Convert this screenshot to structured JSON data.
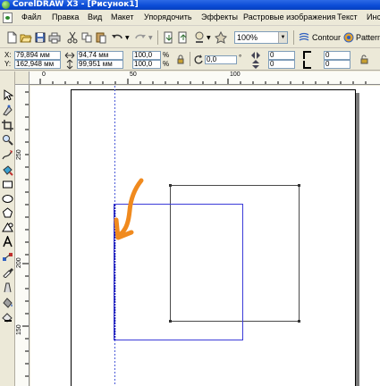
{
  "window": {
    "title": "CorelDRAW X3 - [Рисунок1]"
  },
  "menu": {
    "items": [
      "Файл",
      "Правка",
      "Вид",
      "Макет",
      "Упорядочить",
      "Эффекты",
      "Растровые изображения",
      "Текст",
      "Инс"
    ]
  },
  "toolbar": {
    "zoom_value": "100%",
    "contour_label": "Contour",
    "pattern_label": "Pattern"
  },
  "property_bar": {
    "x_label": "X:",
    "x_value": "79,894 мм",
    "y_label": "Y:",
    "y_value": "162,948 мм",
    "width_value": "94,74 мм",
    "height_value": "99,951 мм",
    "scale_x": "100,0",
    "scale_y": "100,0",
    "percent_1": "%",
    "percent_2": "%",
    "rotation_value": "0,0",
    "degree_symbol": "°",
    "corner_1": "0",
    "corner_2": "0",
    "corner_3": "0",
    "corner_4": "0"
  },
  "rulers": {
    "horizontal_labels": [
      "0",
      "50",
      "100"
    ],
    "vertical_labels": [
      "250",
      "200",
      "150"
    ]
  },
  "colors": {
    "title_bar": "#0a4bd6",
    "selected_rectangle": "#3b3bd8",
    "second_rectangle": "#4a4a4a",
    "arrow_annotation": "#f08a1e",
    "guideline": "#4a5ad8"
  }
}
